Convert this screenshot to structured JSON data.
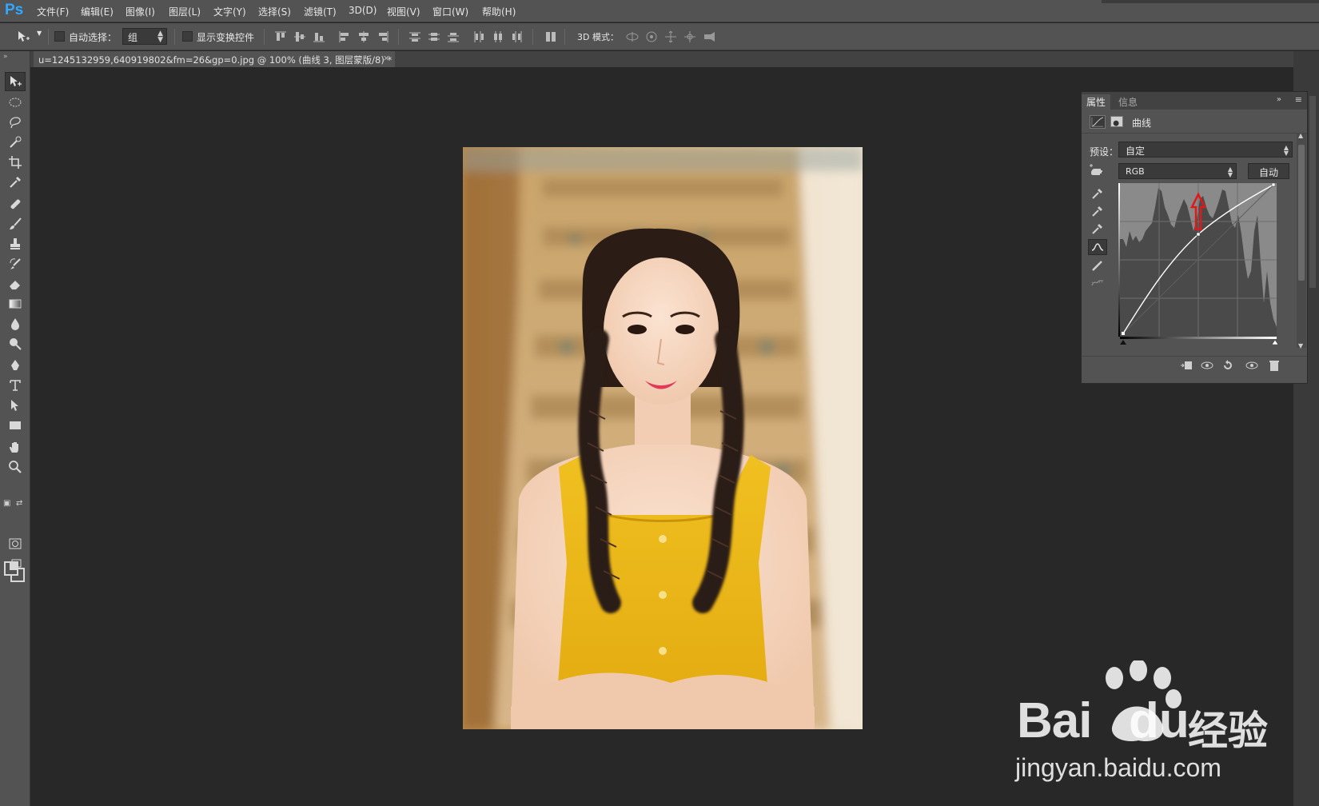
{
  "app": {
    "logo": "Ps"
  },
  "menu": {
    "items": [
      "文件(F)",
      "编辑(E)",
      "图像(I)",
      "图层(L)",
      "文字(Y)",
      "选择(S)",
      "滤镜(T)",
      "3D(D)",
      "视图(V)",
      "窗口(W)",
      "帮助(H)"
    ]
  },
  "options_bar": {
    "auto_select_label": "自动选择：",
    "auto_select_checked": false,
    "auto_select_target": "组",
    "show_transform_label": "显示变换控件",
    "show_transform_checked": false,
    "mode_3d_label": "3D 模式："
  },
  "document": {
    "tab_title": "u=1245132959,640919802&fm=26&gp=0.jpg @ 100% (曲线 3, 图层蒙版/8) *",
    "close_glyph": "×"
  },
  "toolbar": {
    "grip": "»",
    "active_tool": "move-tool"
  },
  "properties_panel": {
    "tabs": [
      "属性",
      "信息"
    ],
    "active_tab": "属性",
    "collapse_glyph": "»",
    "menu_glyph": "≡",
    "adjustment_title": "曲线",
    "preset_label": "预设：",
    "preset_value": "自定",
    "channel_value": "RGB",
    "auto_button": "自动",
    "curve_point": {
      "input": 128,
      "output": 172
    },
    "annotation_color": "#e01818"
  },
  "watermark": {
    "brand_bai": "Bai",
    "brand_du": "du",
    "brand_cn": "经验",
    "url": "jingyan.baidu.com"
  },
  "colors": {
    "menubar": "#535353",
    "canvas": "#282828",
    "accent_logo": "#31a8ff",
    "dress": "#e8b820"
  }
}
